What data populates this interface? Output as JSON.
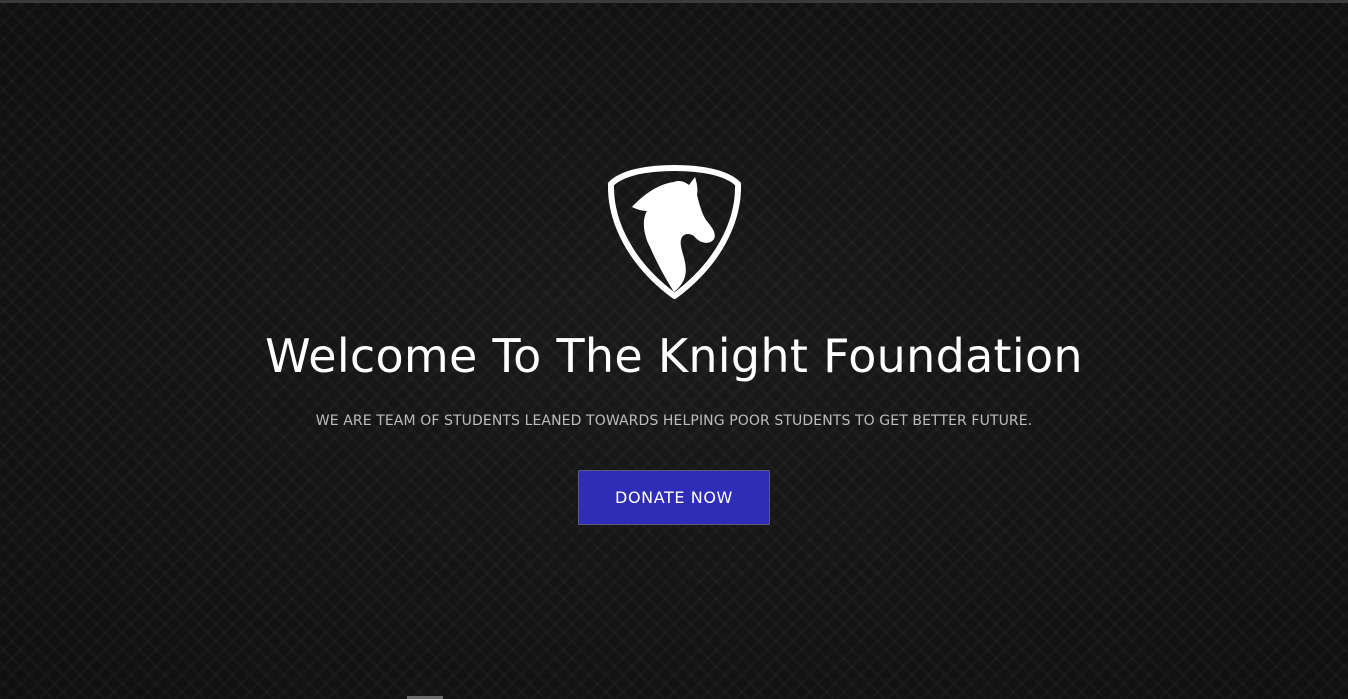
{
  "hero": {
    "logo_icon": "knight-shield-logo",
    "title": "Welcome To The Knight Foundation",
    "subtitle": "WE ARE TEAM OF STUDENTS LEANED TOWARDS HELPING POOR STUDENTS TO GET BETTER FUTURE.",
    "donate_label": "DONATE NOW"
  },
  "colors": {
    "background": "#121212",
    "accent": "#2f2db8",
    "title_text": "#ffffff",
    "subtitle_text": "#bdbdbd"
  }
}
